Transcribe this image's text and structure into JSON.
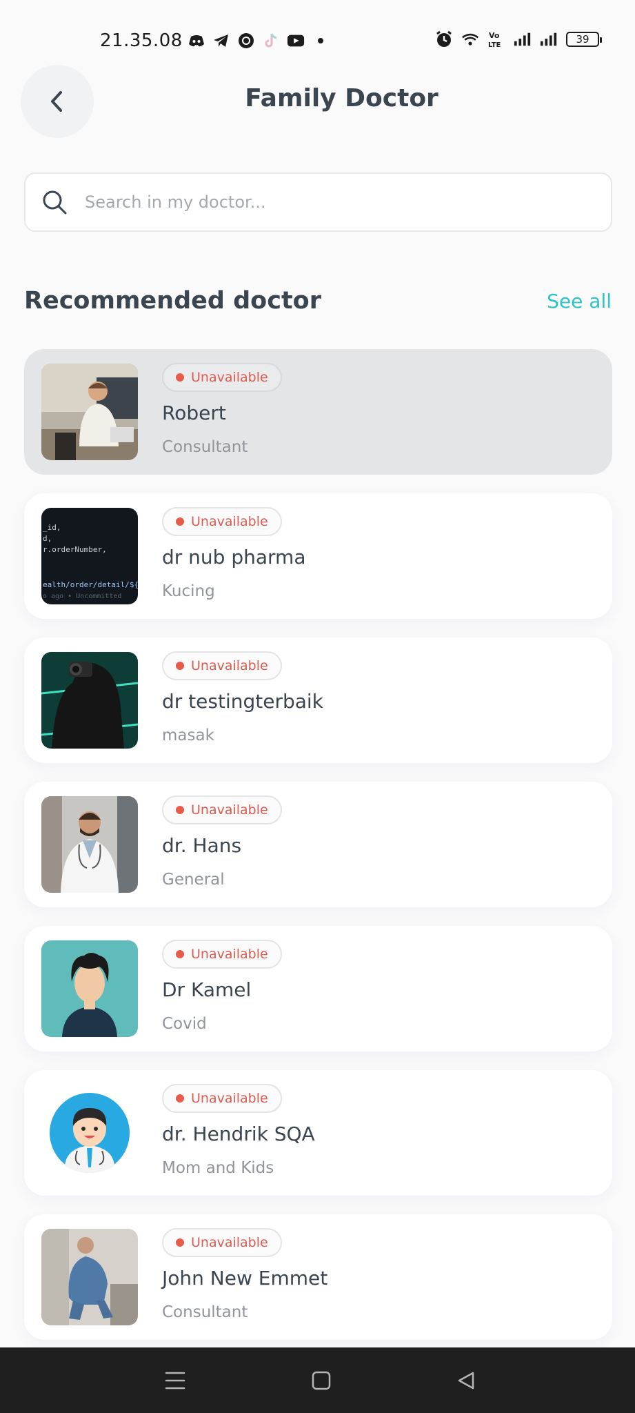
{
  "status_bar": {
    "time": "21.35.08",
    "left_icons": [
      "discord-icon",
      "telegram-icon",
      "chrome-icon",
      "tiktok-icon",
      "youtube-icon",
      "dot-icon"
    ],
    "right_icons": [
      "alarm-icon",
      "wifi-icon",
      "volte-icon",
      "signal-icon",
      "signal-icon"
    ],
    "battery": "39"
  },
  "header": {
    "back_icon": "chevron-left-icon",
    "title": "Family Doctor"
  },
  "search": {
    "placeholder": "Search in my doctor...",
    "value": ""
  },
  "section": {
    "title": "Recommended doctor",
    "see_all": "See all"
  },
  "doctors": [
    {
      "status": "Unavailable",
      "name": "Robert",
      "specialty": "Consultant",
      "selected": true
    },
    {
      "status": "Unavailable",
      "name": "dr nub pharma",
      "specialty": "Kucing",
      "avatar_code": [
        "_id,",
        "d,",
        "r.orderNumber,",
        "ealth/order/detail/${",
        "o ago • Uncommitted"
      ]
    },
    {
      "status": "Unavailable",
      "name": "dr testingterbaik",
      "specialty": "masak"
    },
    {
      "status": "Unavailable",
      "name": "dr. Hans",
      "specialty": "General"
    },
    {
      "status": "Unavailable",
      "name": "Dr Kamel",
      "specialty": "Covid"
    },
    {
      "status": "Unavailable",
      "name": "dr. Hendrik SQA",
      "specialty": "Mom and Kids"
    },
    {
      "status": "Unavailable",
      "name": "John New Emmet",
      "specialty": "Consultant"
    }
  ],
  "colors": {
    "accent": "#2ec4c4",
    "unavailable": "#e85a4a",
    "title": "#3a4550"
  },
  "bottom_nav": [
    "menu-icon",
    "home-icon",
    "back-icon"
  ]
}
